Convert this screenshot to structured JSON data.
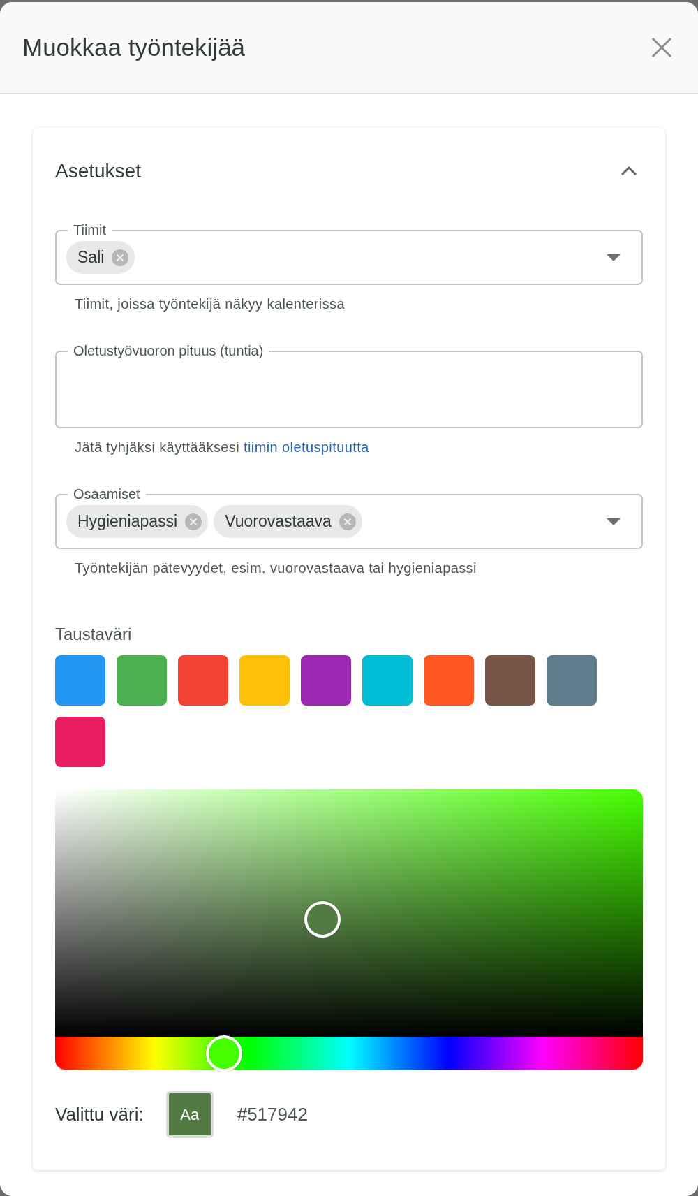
{
  "dialog": {
    "title": "Muokkaa työntekijää"
  },
  "section": {
    "title": "Asetukset",
    "expanded": true
  },
  "fields": [
    {
      "kind": "chips",
      "label": "Tiimit",
      "chips": [
        "Sali"
      ],
      "helper": "Tiimit, joissa työntekijä näkyy kalenterissa"
    },
    {
      "kind": "text",
      "label": "Oletustyövuoron pituus (tuntia)",
      "helper": "Jätä tyhjäksi käyttääksesi",
      "helper_link": "tiimin oletuspituutta"
    },
    {
      "kind": "chips",
      "label": "Osaamiset",
      "chips": [
        "Hygieniapassi",
        "Vuorovastaava"
      ],
      "helper": "Työntekijän pätevyydet, esim. vuorovastaava tai hygieniapassi"
    }
  ],
  "background_color": {
    "label": "Taustaväri",
    "swatches": [
      {
        "color": "#2196f3",
        "selected": false
      },
      {
        "color": "#4caf50",
        "selected": false
      },
      {
        "color": "#f44336",
        "selected": false
      },
      {
        "color": "#ffc107",
        "selected": false
      },
      {
        "color": "#9c27b0",
        "selected": false
      },
      {
        "color": "#00bcd4",
        "selected": false
      },
      {
        "color": "#ff5722",
        "selected": false
      },
      {
        "color": "#795548",
        "selected": false
      },
      {
        "color": "#607d8b",
        "selected": false
      },
      {
        "color": "#e91e63",
        "selected": false
      }
    ]
  },
  "color_picker": {
    "hue": {
      "level": 0.288
    }
  },
  "selected_color": {
    "label": "Valittu väri:",
    "preview_text": "Aa",
    "color": "#517942",
    "hex": "#517942"
  }
}
